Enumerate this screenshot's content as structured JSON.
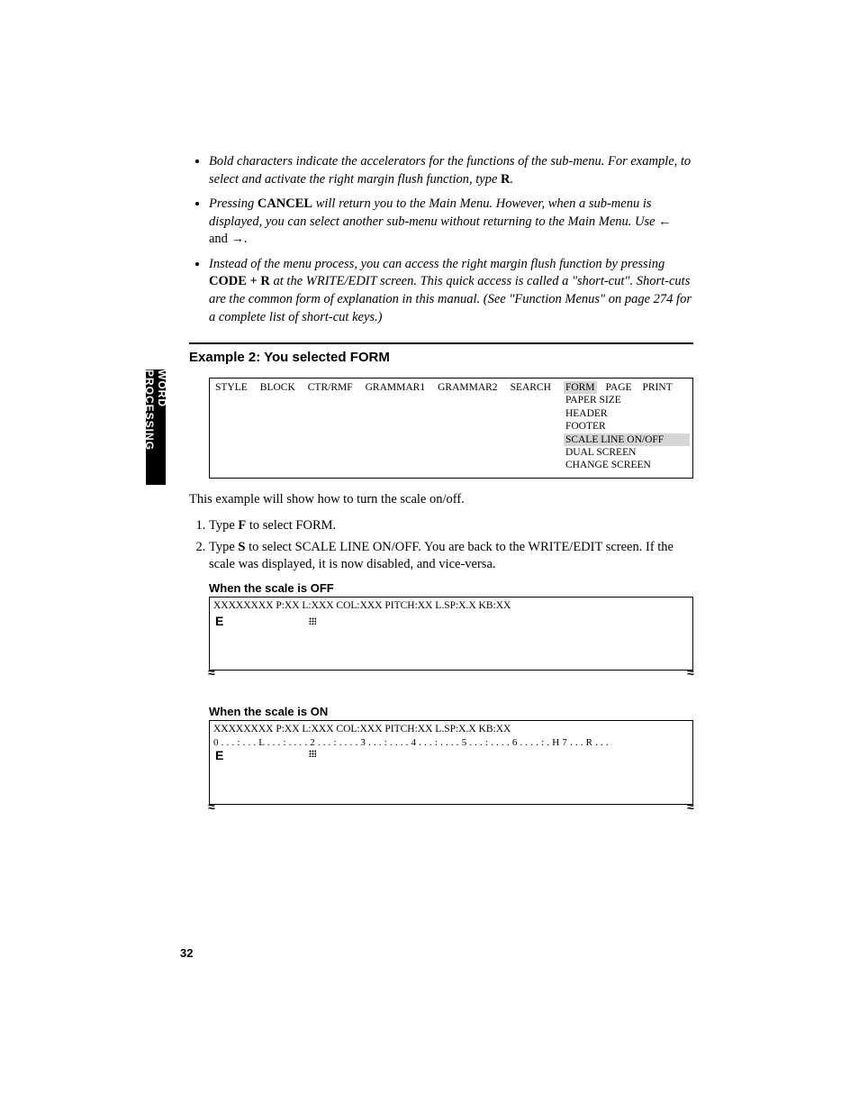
{
  "side_tab": "WORD PROCESSING",
  "notes": {
    "n1": {
      "pre": "Bold characters indicate the accelerators for the functions of the sub-menu. For example, to select and activate the right margin flush function, type ",
      "key": "R",
      "post": "."
    },
    "n2": {
      "pre": "Pressing ",
      "key": "CANCEL",
      "mid": " will return you to the Main Menu. However, when a sub-menu is displayed, you can select another sub-menu without returning to the Main Menu. Use ",
      "arrows": "← and →",
      "post": "."
    },
    "n3": {
      "pre": "Instead of the menu process, you can access the right margin flush function by pressing ",
      "key": "CODE + R",
      "mid": " at the WRITE/EDIT screen. This quick access is called a \"short-cut\". Short-cuts are the common form of explanation in this manual. (See \"Function Menus\" on page 274 for a complete list of short-cut keys.)"
    }
  },
  "section_heading": "Example 2: You selected FORM",
  "menu": {
    "items": [
      "STYLE",
      "BLOCK",
      "CTR/RMF",
      "GRAMMAR1",
      "GRAMMAR2",
      "SEARCH",
      "FORM",
      "PAGE",
      "PRINT"
    ],
    "selected": "FORM",
    "submenu": [
      "PAPER SIZE",
      "HEADER",
      "FOOTER",
      "SCALE LINE ON/OFF",
      "DUAL SCREEN",
      "CHANGE SCREEN"
    ],
    "submenu_selected": "SCALE LINE ON/OFF"
  },
  "intro": "This example will show how to turn the scale on/off.",
  "steps": {
    "s1": {
      "pre": "Type ",
      "key": "F",
      "post": " to select FORM."
    },
    "s2": {
      "pre": "Type ",
      "key": "S",
      "post": " to select SCALE LINE ON/OFF. You are back to the WRITE/EDIT screen. If the scale was displayed, it is now disabled, and vice-versa."
    }
  },
  "scale_off": {
    "label": "When the scale is OFF",
    "status": "XXXXXXXX P:XX L:XXX COL:XXX PITCH:XX L.SP:X.X KB:XX",
    "cursor": "E",
    "tick": "≈"
  },
  "scale_on": {
    "label": "When the scale is ON",
    "status": "XXXXXXXX P:XX L:XXX COL:XXX PITCH:XX L.SP:X.X KB:XX",
    "ruler": "0 . . . : . . . L . . . : . . . . 2 . . . : . . . . 3 . . . : . . . . 4 . . . : . . . . 5 . . . : . . . . 6 . . . . : . H 7 . . . R . . .",
    "cursor": "E",
    "tick": "≈"
  },
  "page_number": "32"
}
